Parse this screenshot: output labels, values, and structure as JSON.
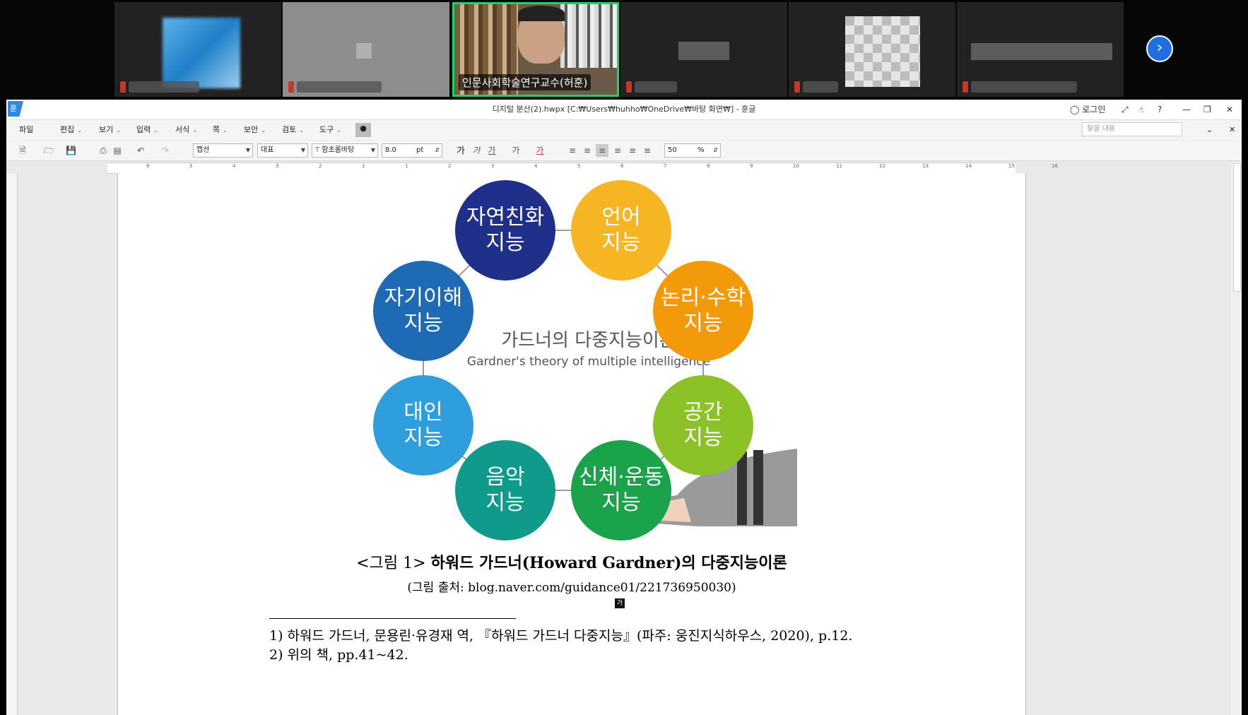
{
  "meeting": {
    "active_participant_name": "인문사회학술연구교수(허훈)",
    "next_page_icon": "chevron-right-icon"
  },
  "window": {
    "title": "디지털 분산(2).hwpx [C:₩Users₩huhho₩OneDrive₩바탕 화면₩] - 훈글",
    "login_label": "로그인"
  },
  "menu": {
    "items": [
      "파일",
      "편집",
      "보기",
      "입력",
      "서식",
      "쪽",
      "보안",
      "검토",
      "도구"
    ],
    "find_placeholder": "찾을 내용"
  },
  "toolbar": {
    "style": "캡션",
    "language": "대표",
    "font": "함초롬바탕",
    "font_size": "8.0",
    "size_unit": "pt",
    "zoom": "50",
    "zoom_unit": "%",
    "char_buttons": [
      "가",
      "가",
      "가",
      "가",
      "가"
    ]
  },
  "ruler": {
    "numbers": [
      "6",
      "5",
      "4",
      "3",
      "2",
      "1",
      "1",
      "2",
      "3",
      "4",
      "5",
      "6",
      "7",
      "8",
      "9",
      "10",
      "11",
      "12",
      "13",
      "14",
      "15",
      "16"
    ]
  },
  "figure": {
    "title_ko": "가드너의 다중지능이론",
    "title_en": "Gardner's theory of multiple intelligence",
    "intelligences": [
      {
        "label": "자연친화\n지능",
        "color": "#1f2f8a"
      },
      {
        "label": "언어\n지능",
        "color": "#f6b624"
      },
      {
        "label": "논리·수학\n지능",
        "color": "#f39a0a"
      },
      {
        "label": "공간\n지능",
        "color": "#8cc227"
      },
      {
        "label": "신체·운동\n지능",
        "color": "#1aa34a"
      },
      {
        "label": "음악\n지능",
        "color": "#0f9a8c"
      },
      {
        "label": "대인\n지능",
        "color": "#2e9edc"
      },
      {
        "label": "자기이해\n지능",
        "color": "#1f6ab4"
      }
    ]
  },
  "caption": {
    "prefix": "<그림 1>",
    "title": "하워드 가드너(Howard Gardner)의 다중지능이론",
    "source": "(그림 출처: blog.naver.com/guidance01/221736950030)",
    "cursor_char": "가"
  },
  "footnotes": [
    "1) 하워드 가드너, 문용린·유경재 역, 『하워드 가드너 다중지능』(파주: 웅진지식하우스, 2020), p.12.",
    "2) 위의 책, pp.41~42."
  ]
}
